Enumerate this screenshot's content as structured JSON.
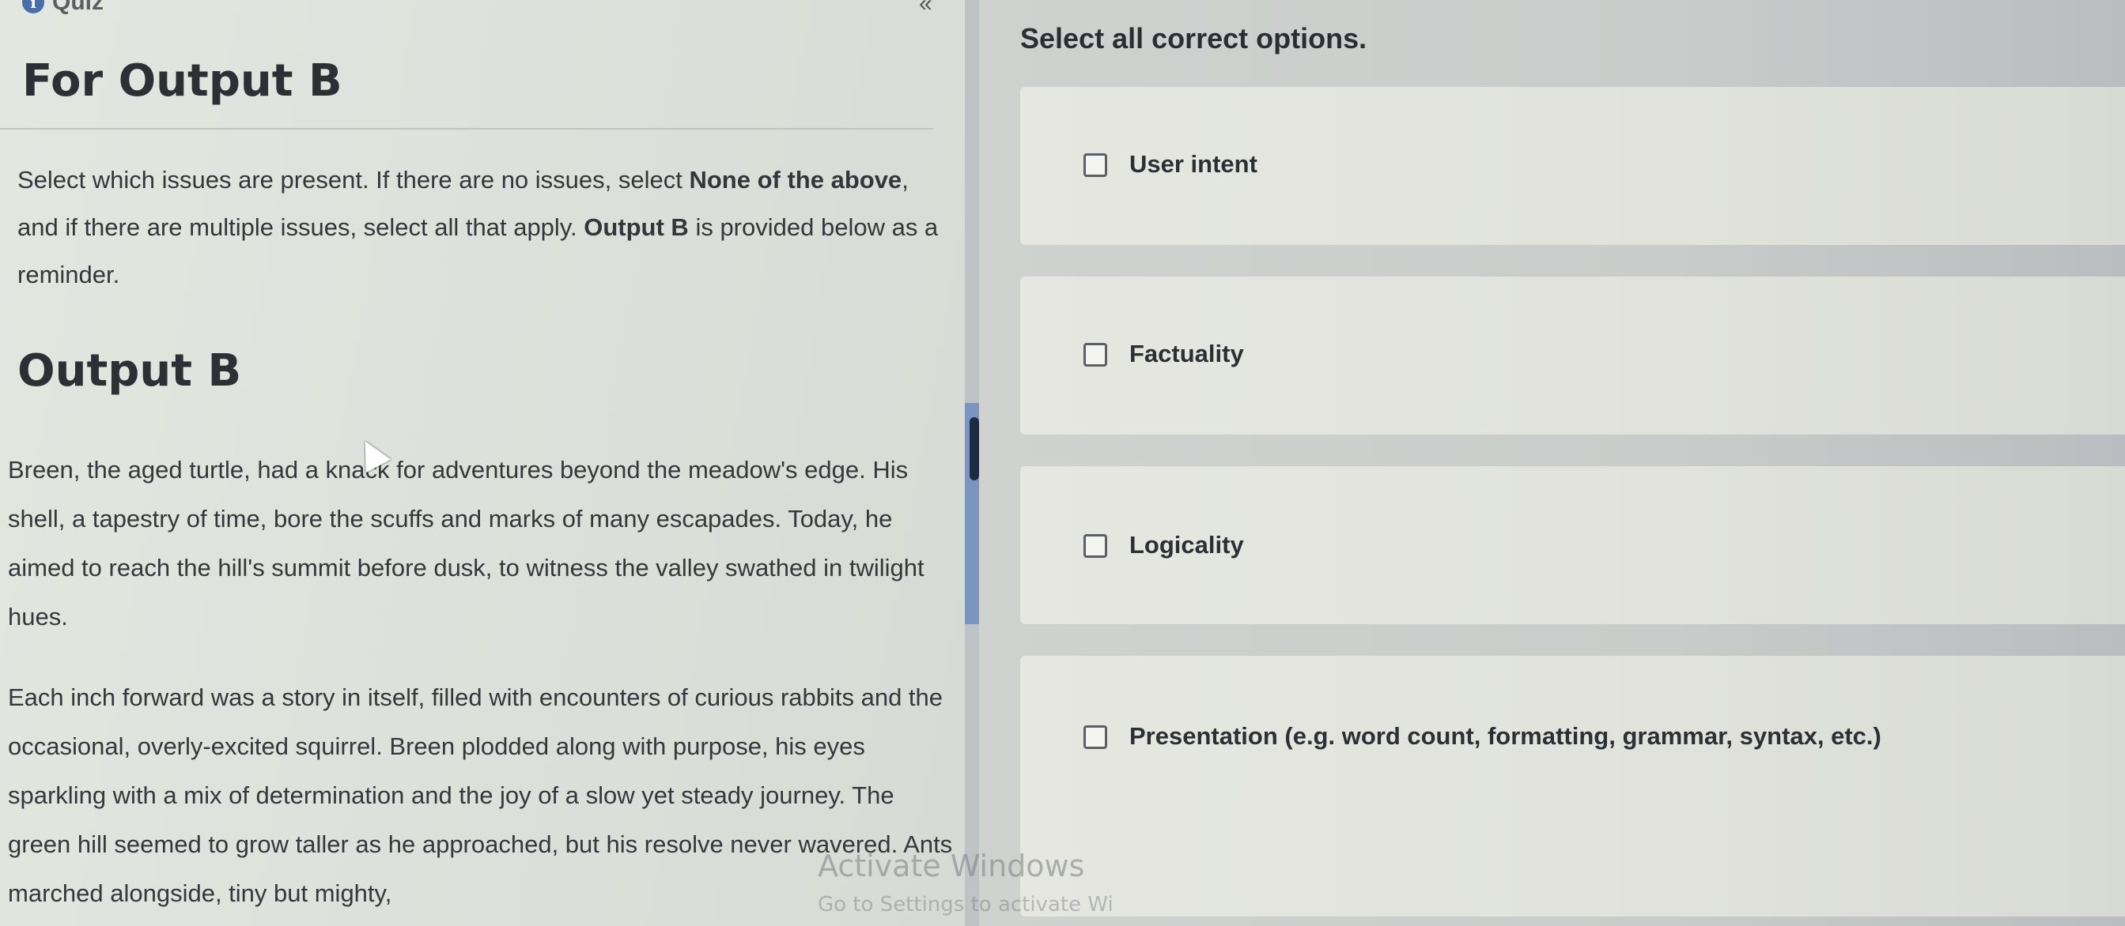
{
  "header": {
    "tab_label": "Quiz",
    "collapse_glyph": "«"
  },
  "left": {
    "section_title": "For Output B",
    "instructions": {
      "part1": "Select which issues are present. If there are no issues, select ",
      "bold1": "None of the above",
      "part2": ", and if there are multiple issues, select all that apply. ",
      "bold2": "Output B",
      "part3": " is provided below as a reminder."
    },
    "output_title": "Output B",
    "story": [
      "Breen, the aged turtle, had a knack for adventures beyond the meadow's edge. His shell, a tapestry of time, bore the scuffs and marks of many escapades. Today, he aimed to reach the hill's summit before dusk, to witness the valley swathed in twilight hues.",
      "Each inch forward was a story in itself, filled with encounters of curious rabbits and the occasional, overly-excited squirrel. Breen plodded along with purpose, his eyes sparkling with a mix of determination and the joy of a slow yet steady journey. The green hill seemed to grow taller as he approached, but his resolve never wavered. Ants marched alongside, tiny but mighty,"
    ]
  },
  "right": {
    "prompt": "Select all correct options.",
    "options": [
      {
        "label": "User intent",
        "checked": false
      },
      {
        "label": "Factuality",
        "checked": false
      },
      {
        "label": "Logicality",
        "checked": false
      },
      {
        "label": "Presentation (e.g. word count, formatting, grammar, syntax, etc.)",
        "checked": false
      }
    ]
  },
  "watermark": {
    "title": "Activate Windows",
    "subtitle": "Go to Settings to activate Wi"
  },
  "colors": {
    "scroll_accent": "#7a96c0",
    "scroll_thumb": "#1d2a44",
    "info_icon": "#4a6fa5"
  }
}
